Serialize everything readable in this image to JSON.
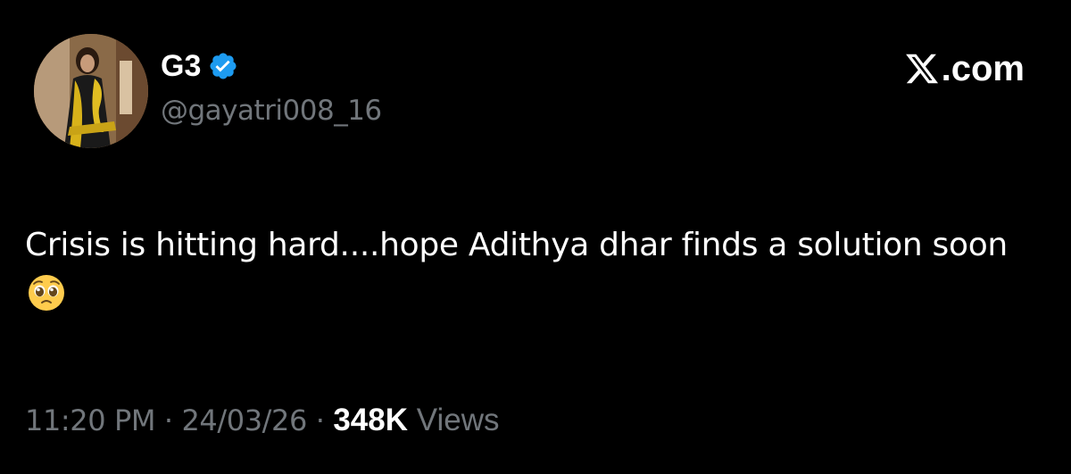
{
  "author": {
    "display_name": "G3",
    "handle": "@gayatri008_16",
    "verified": true,
    "verified_color": "#1d9bf0",
    "avatar_icon": "profile-photo"
  },
  "brand": {
    "icon": "x-logo-icon",
    "text": ".com"
  },
  "tweet": {
    "text": "Crisis is hitting hard....hope Adithya dhar finds a solution soon",
    "emoji": "pleading-face-emoji"
  },
  "meta": {
    "time": "11:20 PM",
    "separator": "·",
    "date": "24/03/26",
    "views_count": "348K",
    "views_label": "Views"
  },
  "colors": {
    "background": "#000000",
    "primary_text": "#ffffff",
    "secondary_text": "#71767b"
  }
}
